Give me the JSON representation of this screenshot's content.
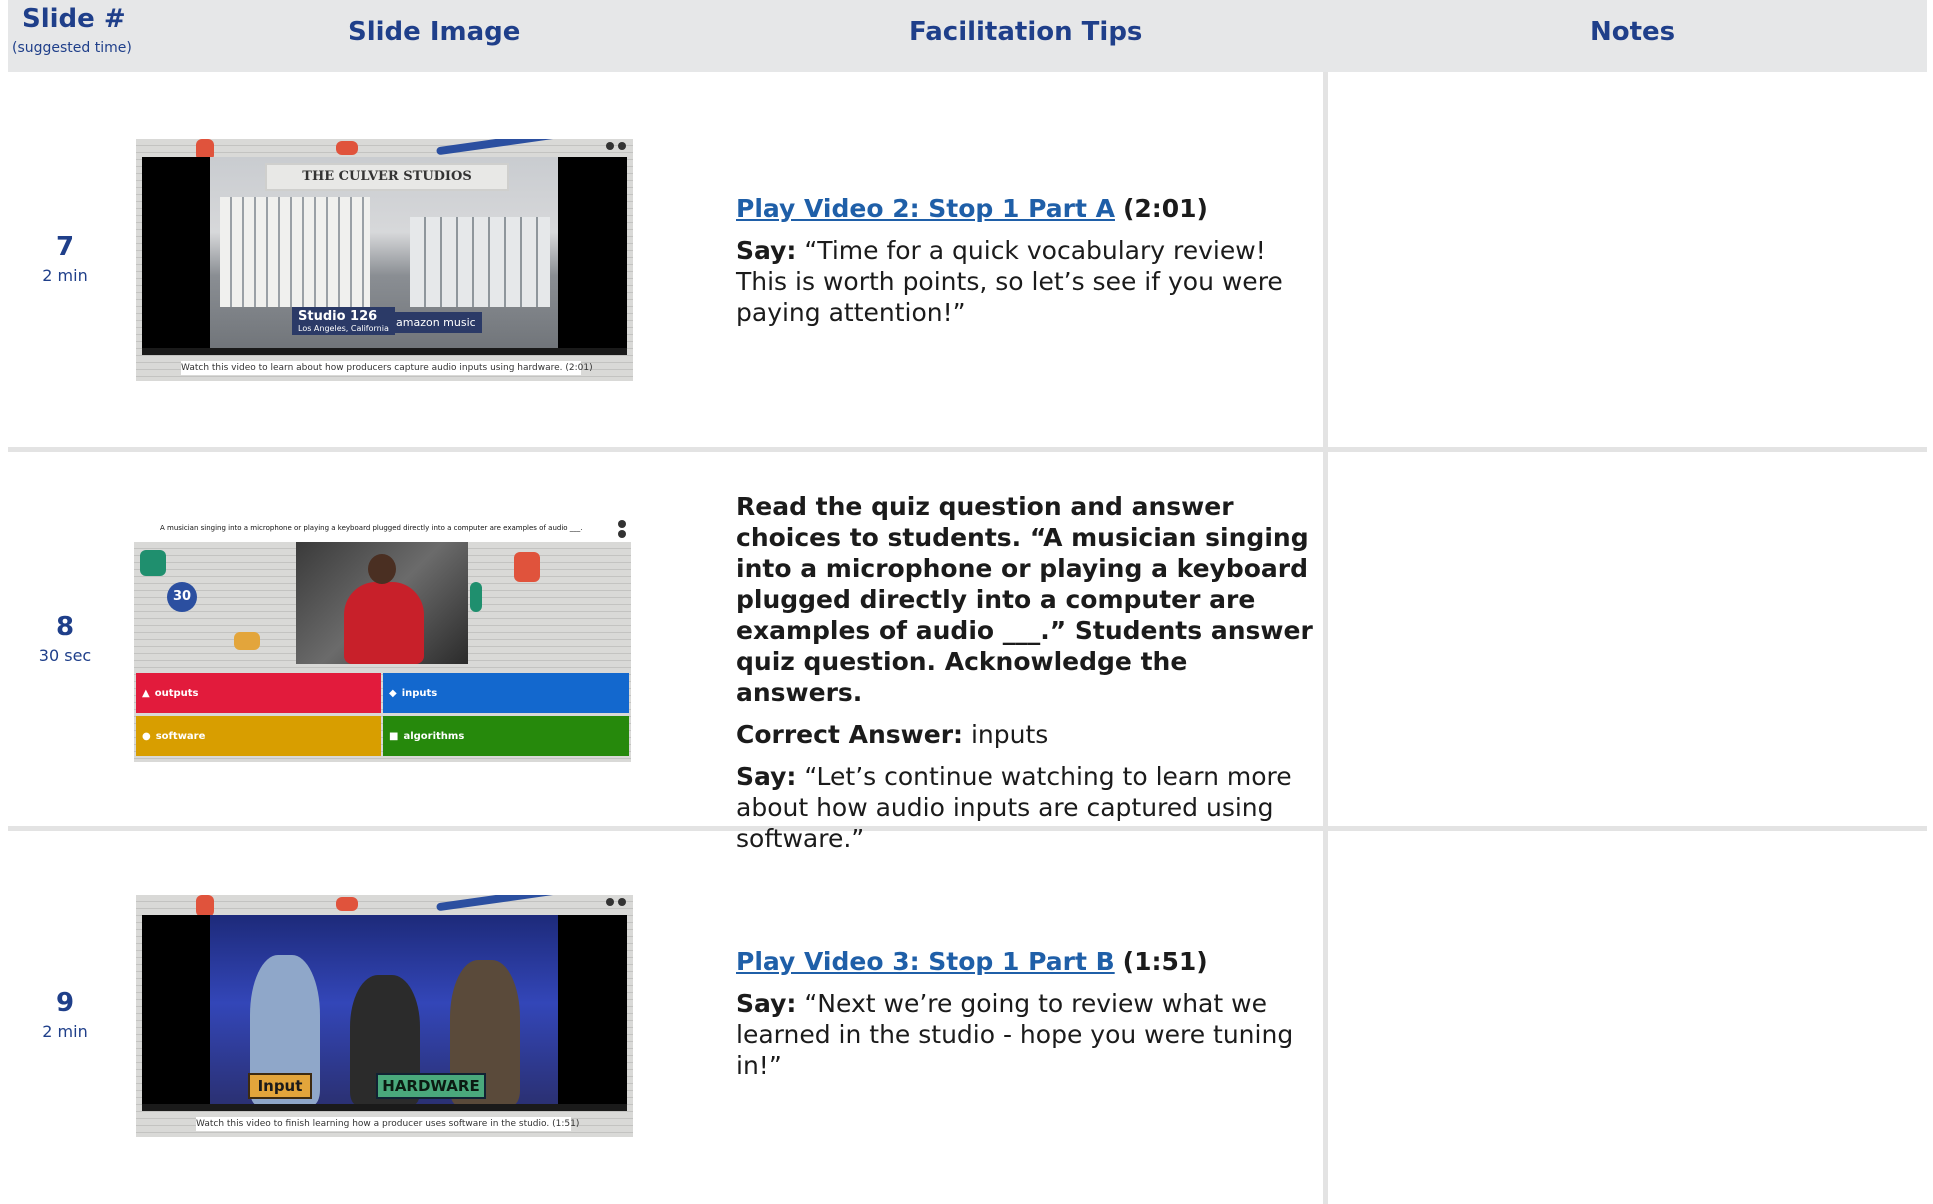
{
  "header": {
    "slide_col": "Slide #",
    "slide_col_sub": "(suggested time)",
    "image_col": "Slide Image",
    "tips_col": "Facilitation Tips",
    "notes_col": "Notes"
  },
  "rows": [
    {
      "number": "7",
      "duration": "2 min",
      "thumb": {
        "arch_text": "THE CULVER STUDIOS",
        "location_title": "Studio 126",
        "location_sub": "Los Angeles, California",
        "brand": "amazon music",
        "caption": "Watch this video to learn about how producers capture audio inputs using hardware. (2:01)"
      },
      "link_text": "Play Video 2: Stop 1 Part A",
      "link_time": "(2:01)",
      "say_label": "Say:",
      "say_text": "“Time for a quick vocabulary review! This is worth points, so let’s see if you were paying attention!”"
    },
    {
      "number": "8",
      "duration": "30 sec",
      "thumb": {
        "question": "A musician singing into a microphone or playing a keyboard plugged directly into a computer are examples of audio ___.",
        "timer": "30",
        "answers": [
          {
            "label": "outputs",
            "color": "#e21b3c",
            "shape": "▲"
          },
          {
            "label": "inputs",
            "color": "#1368ce",
            "shape": "◆"
          },
          {
            "label": "software",
            "color": "#d89e00",
            "shape": "●"
          },
          {
            "label": "algorithms",
            "color": "#26890c",
            "shape": "■"
          }
        ]
      },
      "instruction": "Read the quiz question and answer choices to students. “A musician singing into a microphone or playing a keyboard plugged directly into a computer are examples of audio ___.” Students answer quiz question. Acknowledge the answers.",
      "answer_label": "Correct Answer:",
      "answer_text": "inputs",
      "say_label": "Say:",
      "say_text": "“Let’s continue watching to learn more about how audio inputs are captured using software.”"
    },
    {
      "number": "9",
      "duration": "2 min",
      "thumb": {
        "tag_input": "Input",
        "tag_hardware": "HARDWARE",
        "caption": "Watch this video to finish learning how a producer uses software in the studio. (1:51)"
      },
      "link_text": "Play Video 3: Stop 1 Part B",
      "link_time": "(1:51)",
      "say_label": "Say:",
      "say_text": "“Next we’re going to review what we learned in the studio - hope you were tuning in!”"
    }
  ],
  "colors": {
    "heading_blue": "#1f3f8a",
    "link_blue": "#1f5fa8",
    "header_gray": "#e6e7e8",
    "divider_gray": "#e3e3e3"
  }
}
